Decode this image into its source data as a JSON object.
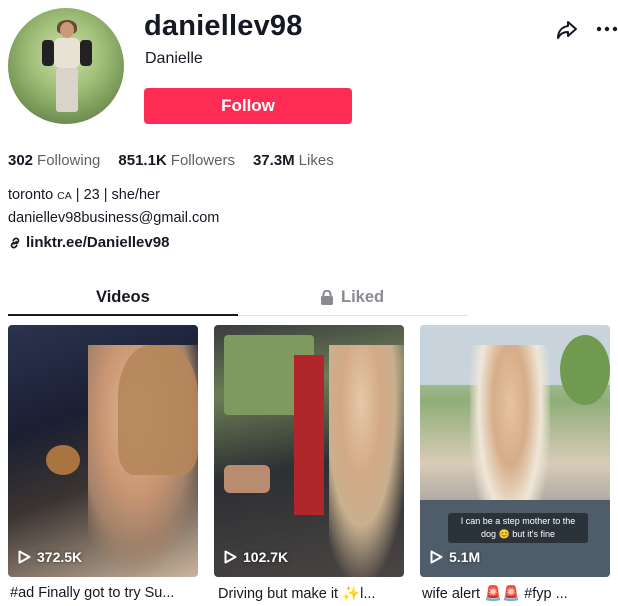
{
  "profile": {
    "username": "daniellev98",
    "nickname": "Danielle",
    "follow_label": "Follow"
  },
  "stats": {
    "following_count": "302",
    "following_label": "Following",
    "followers_count": "851.1K",
    "followers_label": "Followers",
    "likes_count": "37.3M",
    "likes_label": "Likes"
  },
  "bio": {
    "line1_prefix": "toronto ",
    "line1_country": "CA",
    "line1_suffix": " | 23 | she/her",
    "line2": "daniellev98business@gmail.com",
    "link": "linktr.ee/Daniellev98"
  },
  "tabs": {
    "videos": "Videos",
    "liked": "Liked"
  },
  "videos": [
    {
      "views": "372.5K",
      "caption": "#ad Finally got to try Su..."
    },
    {
      "views": "102.7K",
      "caption": "Driving but make it ✨l..."
    },
    {
      "views": "5.1M",
      "caption": "wife alert 🚨🚨 #fyp ...",
      "overlay": "I can be a step mother to the dog 😊 but it's fine"
    }
  ],
  "icons": {
    "share": "share-icon",
    "more": "more-icon",
    "link": "link-icon",
    "lock": "lock-icon",
    "play": "play-icon"
  },
  "colors": {
    "follow_button": "#fe2c55",
    "text_primary": "#161823",
    "text_secondary": "#616161"
  }
}
